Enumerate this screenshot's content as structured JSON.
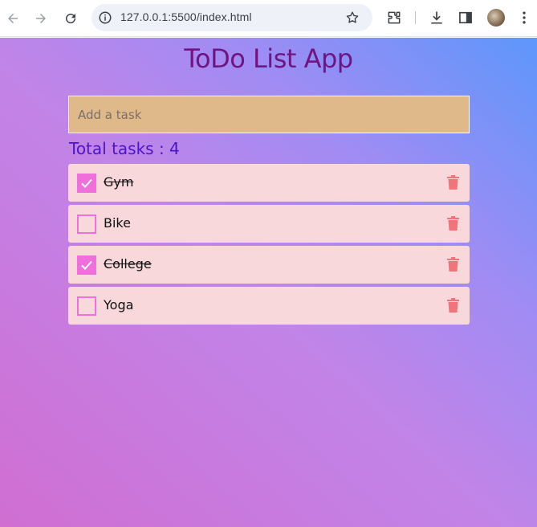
{
  "browser": {
    "url": "127.0.0.1:5500/index.html",
    "icons": [
      "back-arrow-icon",
      "forward-arrow-icon",
      "reload-icon",
      "site-info-icon",
      "bookmark-star-icon",
      "extensions-puzzle-icon",
      "download-icon",
      "side-panel-icon",
      "profile-avatar",
      "kebab-menu-icon"
    ]
  },
  "app": {
    "title": "ToDo List App",
    "input_placeholder": "Add a task",
    "total_label": "Total tasks : 4",
    "tasks": [
      {
        "label": "Gym",
        "checked": true
      },
      {
        "label": "Bike",
        "checked": false
      },
      {
        "label": "College",
        "checked": true
      },
      {
        "label": "Yoga",
        "checked": false
      }
    ]
  },
  "colors": {
    "title": "#6f1480",
    "total": "#4a14c9",
    "input_bg": "#dfb98a",
    "task_bg": "#f9d8dc",
    "checkbox": "#ef6fdb",
    "trash": "#f0747a"
  }
}
